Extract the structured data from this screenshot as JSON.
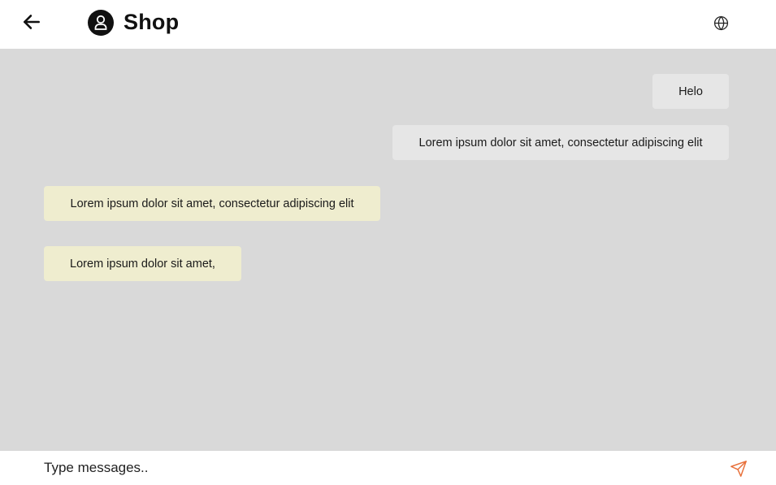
{
  "header": {
    "title": "Shop",
    "back_icon": "arrow-left-icon",
    "avatar_icon": "user-icon",
    "globe_icon": "globe-icon"
  },
  "messages": [
    {
      "from": "me",
      "text": "Helo"
    },
    {
      "from": "me",
      "text": "Lorem ipsum dolor sit amet, consectetur adipiscing elit"
    },
    {
      "from": "shop",
      "text": "Lorem ipsum dolor sit amet, consectetur adipiscing elit"
    },
    {
      "from": "shop",
      "text": "Lorem ipsum dolor sit amet,"
    }
  ],
  "composer": {
    "placeholder": "Type messages..",
    "value": "",
    "send_icon": "send-icon"
  },
  "colors": {
    "chat_background": "#d9d9d9",
    "sent_bubble": "#e6e6e6",
    "received_bubble": "#efedcf",
    "send_icon": "#e8703a"
  }
}
